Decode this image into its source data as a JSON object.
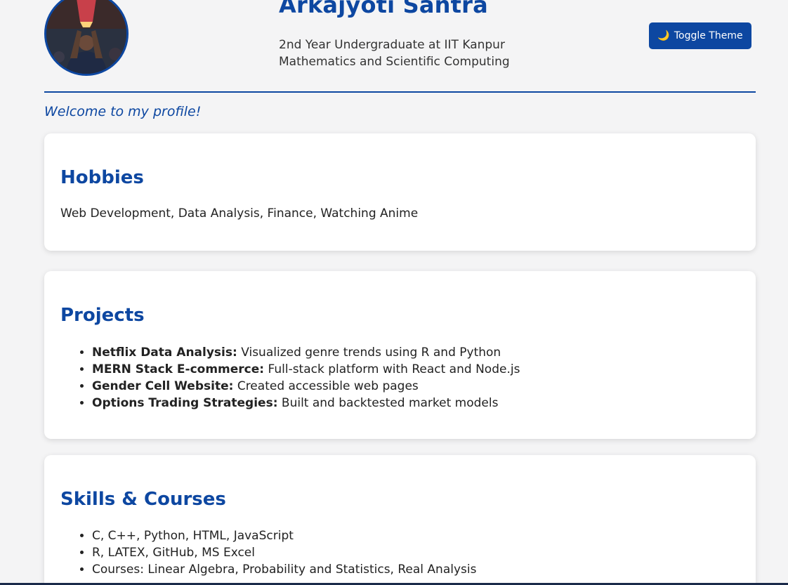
{
  "header": {
    "name": "Arkajyoti Santra",
    "subtitle_line1": "2nd Year Undergraduate at IIT Kanpur",
    "subtitle_line2": "Mathematics and Scientific Computing",
    "toggle_label": "Toggle Theme",
    "toggle_icon": "moon-icon"
  },
  "welcome": "Welcome to my profile!",
  "hobbies": {
    "title": "Hobbies",
    "text": "Web Development, Data Analysis, Finance, Watching Anime"
  },
  "projects": {
    "title": "Projects",
    "items": [
      {
        "name": "Netflix Data Analysis:",
        "desc": " Visualized genre trends using R and Python"
      },
      {
        "name": "MERN Stack E-commerce:",
        "desc": " Full-stack platform with React and Node.js"
      },
      {
        "name": "Gender Cell Website:",
        "desc": " Created accessible web pages"
      },
      {
        "name": "Options Trading Strategies:",
        "desc": " Built and backtested market models"
      }
    ]
  },
  "skills": {
    "title": "Skills & Courses",
    "items": [
      "C, C++, Python, HTML, JavaScript",
      "R, LATEX, GitHub, MS Excel",
      "Courses: Linear Algebra, Probability and Statistics, Real Analysis"
    ]
  },
  "colors": {
    "accent": "#0d47a1",
    "background": "#f4f4f5",
    "card": "#ffffff"
  }
}
